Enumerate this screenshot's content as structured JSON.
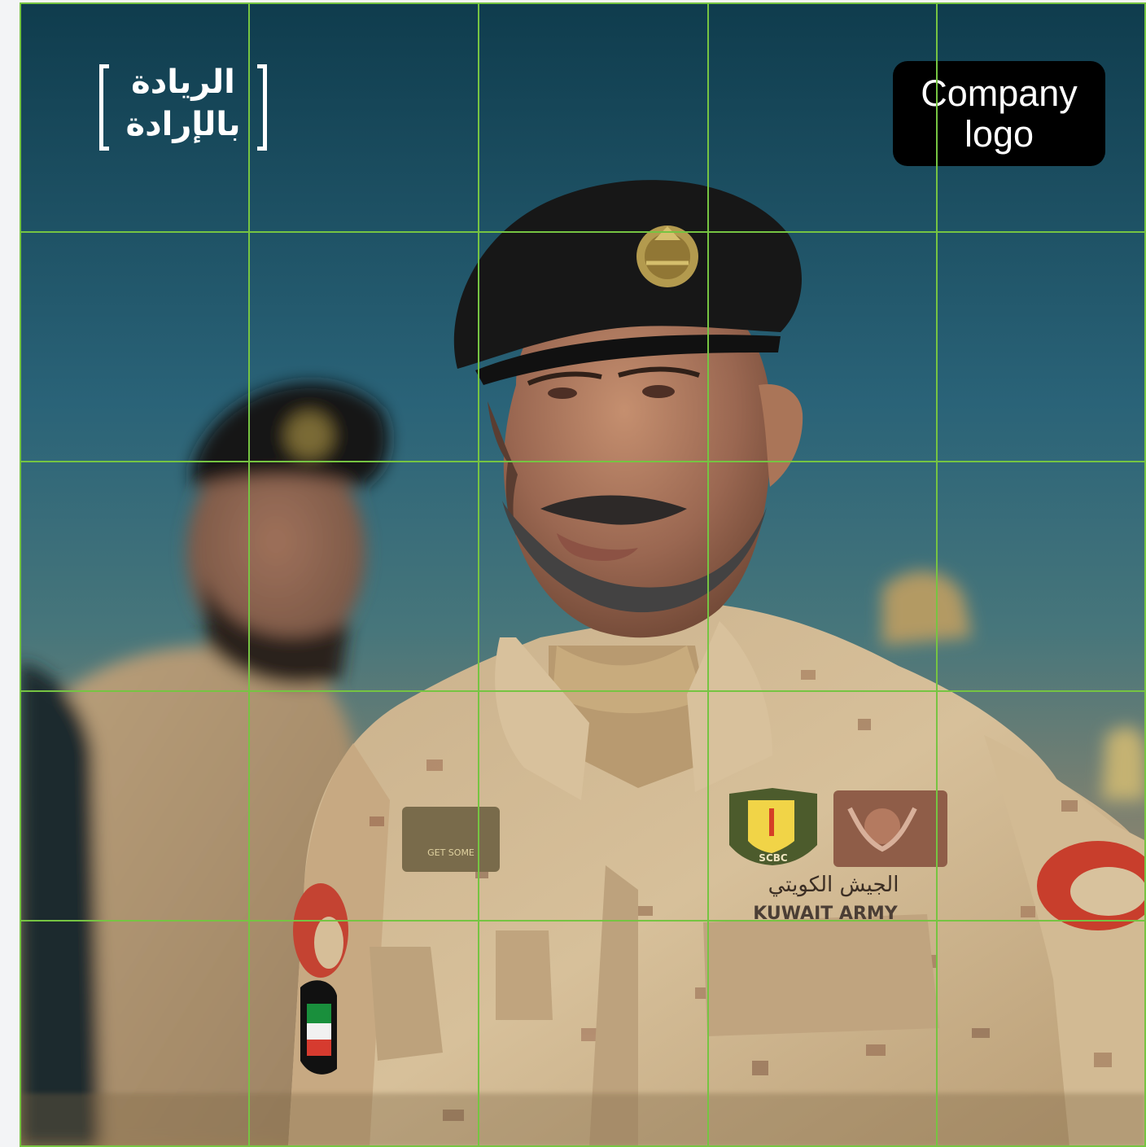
{
  "brand": {
    "arabic_logo_text": "الريادة\nبالإرادة"
  },
  "company_logo": {
    "label": "Company logo"
  },
  "photo": {
    "patch_text": "KUWAIT ARMY",
    "arabic_patch_text": "الجيش الكويتي",
    "badge_text": "SCBC",
    "name_tape": "GET SOME"
  },
  "grid": {
    "columns": 5,
    "rows": 5,
    "line_color": "#76c442"
  },
  "colors": {
    "sky_top": "#0f3c4d",
    "uniform": "#c8b089",
    "beret": "#171717"
  }
}
